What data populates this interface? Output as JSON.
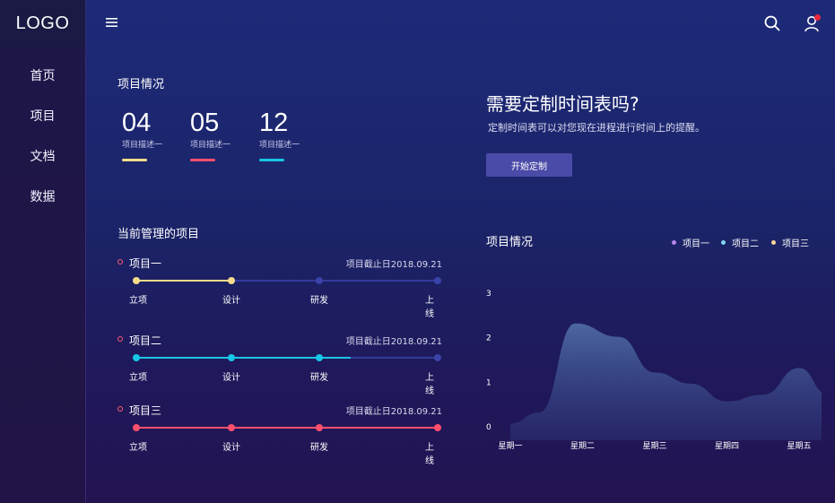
{
  "sidebar": {
    "logo": "LOGO",
    "items": [
      {
        "label": "首页"
      },
      {
        "label": "项目"
      },
      {
        "label": "文档"
      },
      {
        "label": "数据"
      }
    ]
  },
  "header": {
    "icons": [
      "menu-icon",
      "search-icon",
      "user-icon"
    ],
    "notification_color": "#e8283c"
  },
  "overview": {
    "title": "项目情况",
    "stats": [
      {
        "number": "04",
        "desc": "项目描述一",
        "color": "#f6dc8c"
      },
      {
        "number": "05",
        "desc": "项目描述一",
        "color": "#ff4f6d"
      },
      {
        "number": "12",
        "desc": "项目描述一",
        "color": "#18c6e6"
      }
    ]
  },
  "projects": {
    "title": "当前管理的项目",
    "items": [
      {
        "name": "项目一",
        "deadline": "项目截止日2018.09.21",
        "color": "#f6dc8c",
        "progress": 0.32,
        "steps": [
          "立项",
          "设计",
          "研发",
          "上线"
        ]
      },
      {
        "name": "项目二",
        "deadline": "项目截止日2018.09.21",
        "color": "#18c6e6",
        "progress": 0.71,
        "steps": [
          "立项",
          "设计",
          "研发",
          "上线"
        ]
      },
      {
        "name": "项目三",
        "deadline": "项目截止日2018.09.21",
        "color": "#ff4f6d",
        "progress": 1.0,
        "steps": [
          "立项",
          "设计",
          "研发",
          "上线"
        ]
      }
    ]
  },
  "promo": {
    "title": "需要定制时间表吗?",
    "subtitle": "定制时间表可以对您现在进程进行时间上的提醒。",
    "button": "开始定制"
  },
  "chart_data": {
    "type": "area",
    "title": "项目情况",
    "categories": [
      "星期一",
      "星期二",
      "星期三",
      "星期四",
      "星期五"
    ],
    "yticks": [
      "0",
      "1",
      "2",
      "3"
    ],
    "ylim": [
      0,
      3
    ],
    "legend": [
      {
        "name": "项目一",
        "color": "#b486f0"
      },
      {
        "name": "项目二",
        "color": "#7fd8f2"
      },
      {
        "name": "项目三",
        "color": "#f6d49a"
      }
    ],
    "legend_position": "top-right",
    "series": [
      {
        "name": "项目一",
        "x": [
          0,
          0.4,
          0.9,
          1.5,
          2.0,
          2.5,
          3.0,
          3.5,
          4.0,
          4.4
        ],
        "values": [
          0.05,
          0.3,
          2.3,
          2.0,
          1.2,
          0.95,
          0.55,
          0.7,
          1.3,
          0.7
        ]
      }
    ],
    "grid": false
  }
}
